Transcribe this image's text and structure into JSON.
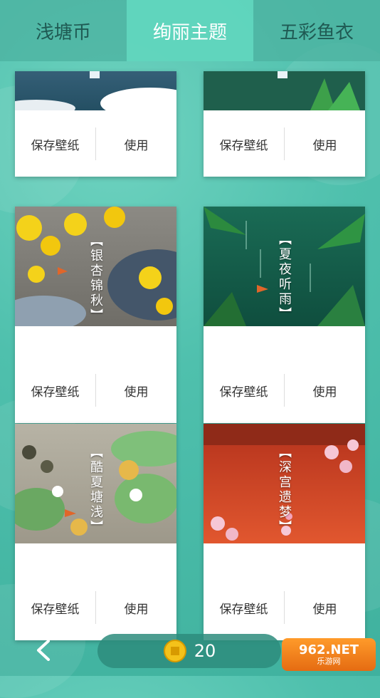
{
  "tabs": [
    {
      "label": "浅塘币"
    },
    {
      "label": "绚丽主题"
    },
    {
      "label": "五彩鱼衣"
    }
  ],
  "cards": [
    {
      "title": "",
      "save_label": "保存壁纸",
      "use_label": "使用"
    },
    {
      "title": "",
      "save_label": "保存壁纸",
      "use_label": "使用"
    },
    {
      "title": "【银杏锦秋】",
      "save_label": "保存壁纸",
      "use_label": "使用"
    },
    {
      "title": "【夏夜听雨】",
      "save_label": "保存壁纸",
      "use_label": "使用"
    },
    {
      "title": "【酷夏塘浅】",
      "save_label": "保存壁纸",
      "use_label": "使用"
    },
    {
      "title": "【深宫遗梦】",
      "save_label": "保存壁纸",
      "use_label": "使用"
    }
  ],
  "footer": {
    "coins": "20",
    "brand_main": "962.NET",
    "brand_sub": "乐游网"
  },
  "colors": {
    "tab_active": "#60d6be",
    "tab_inactive": "#4cb2a0",
    "background": "#4fc0ad"
  }
}
